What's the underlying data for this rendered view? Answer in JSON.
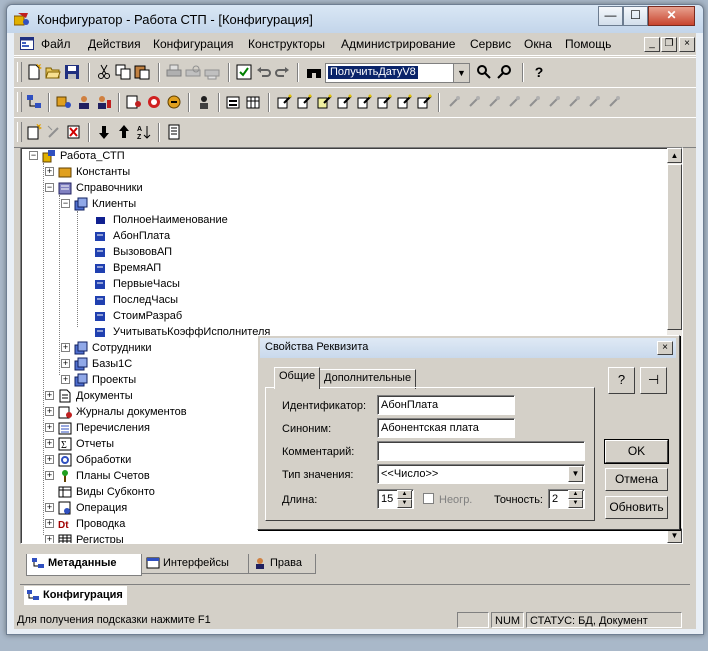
{
  "window": {
    "title": "Конфигуратор - Работа СТП - [Конфигурация]"
  },
  "title_buttons": {
    "minimize": "—",
    "maximize": "☐",
    "close": "✕"
  },
  "menu": [
    "Файл",
    "Действия",
    "Конфигурация",
    "Конструкторы",
    "Администрирование",
    "Сервис",
    "Окна",
    "Помощь"
  ],
  "mdi_buttons": {
    "minimize": "_",
    "restore": "❐",
    "close": "×"
  },
  "toolbar": {
    "combo_value": "ПолучитьДатуV8",
    "combo_arrow": "▼",
    "help_glyph": "?"
  },
  "tree": {
    "root": "Работа_СТП",
    "nodes": [
      "Константы",
      "Справочники",
      "Клиенты",
      "ПолноеНаименование",
      "АбонПлата",
      "ВызововАП",
      "ВремяАП",
      "ПервыеЧасы",
      "ПоследЧасы",
      "СтоимРазраб",
      "УчитыватьКоэффИсполнителя",
      "Сотрудники",
      "Базы1С",
      "Проекты",
      "Документы",
      "Журналы документов",
      "Перечисления",
      "Отчеты",
      "Обработки",
      "Планы Счетов",
      "Виды Субконто",
      "Операция",
      "Проводка",
      "Регистры"
    ],
    "expand_plus": "+",
    "expand_minus": "−"
  },
  "bottom_tabs": [
    "Метаданные",
    "Интерфейсы",
    "Права"
  ],
  "window_tab": "Конфигурация",
  "status": {
    "hint": "Для получения подсказки нажмите F1",
    "num": "NUM",
    "info": "СТАТУС: БД, Документ"
  },
  "dialog": {
    "title": "Свойства Реквизита",
    "close_glyph": "×",
    "tabs": [
      "Общие",
      "Дополнительные"
    ],
    "labels": {
      "identifier": "Идентификатор:",
      "synonym": "Синоним:",
      "comment": "Комментарий:",
      "type": "Тип значения:",
      "length": "Длина:",
      "nonneg": "Неогр.",
      "precision": "Точность:"
    },
    "values": {
      "identifier": "АбонПлата",
      "synonym": "Абонентская плата",
      "comment": "",
      "type": "<<Число>>",
      "length": "15",
      "precision": "2"
    },
    "buttons": {
      "ok": "OK",
      "cancel": "Отмена",
      "update": "Обновить",
      "help": "?",
      "pin": "⊣"
    },
    "spin_up": "▲",
    "spin_down": "▼",
    "select_arrow": "▼"
  },
  "colors": {
    "selection": "#0a246a",
    "face": "#d4d0c8",
    "title": "#c9d9ec"
  }
}
